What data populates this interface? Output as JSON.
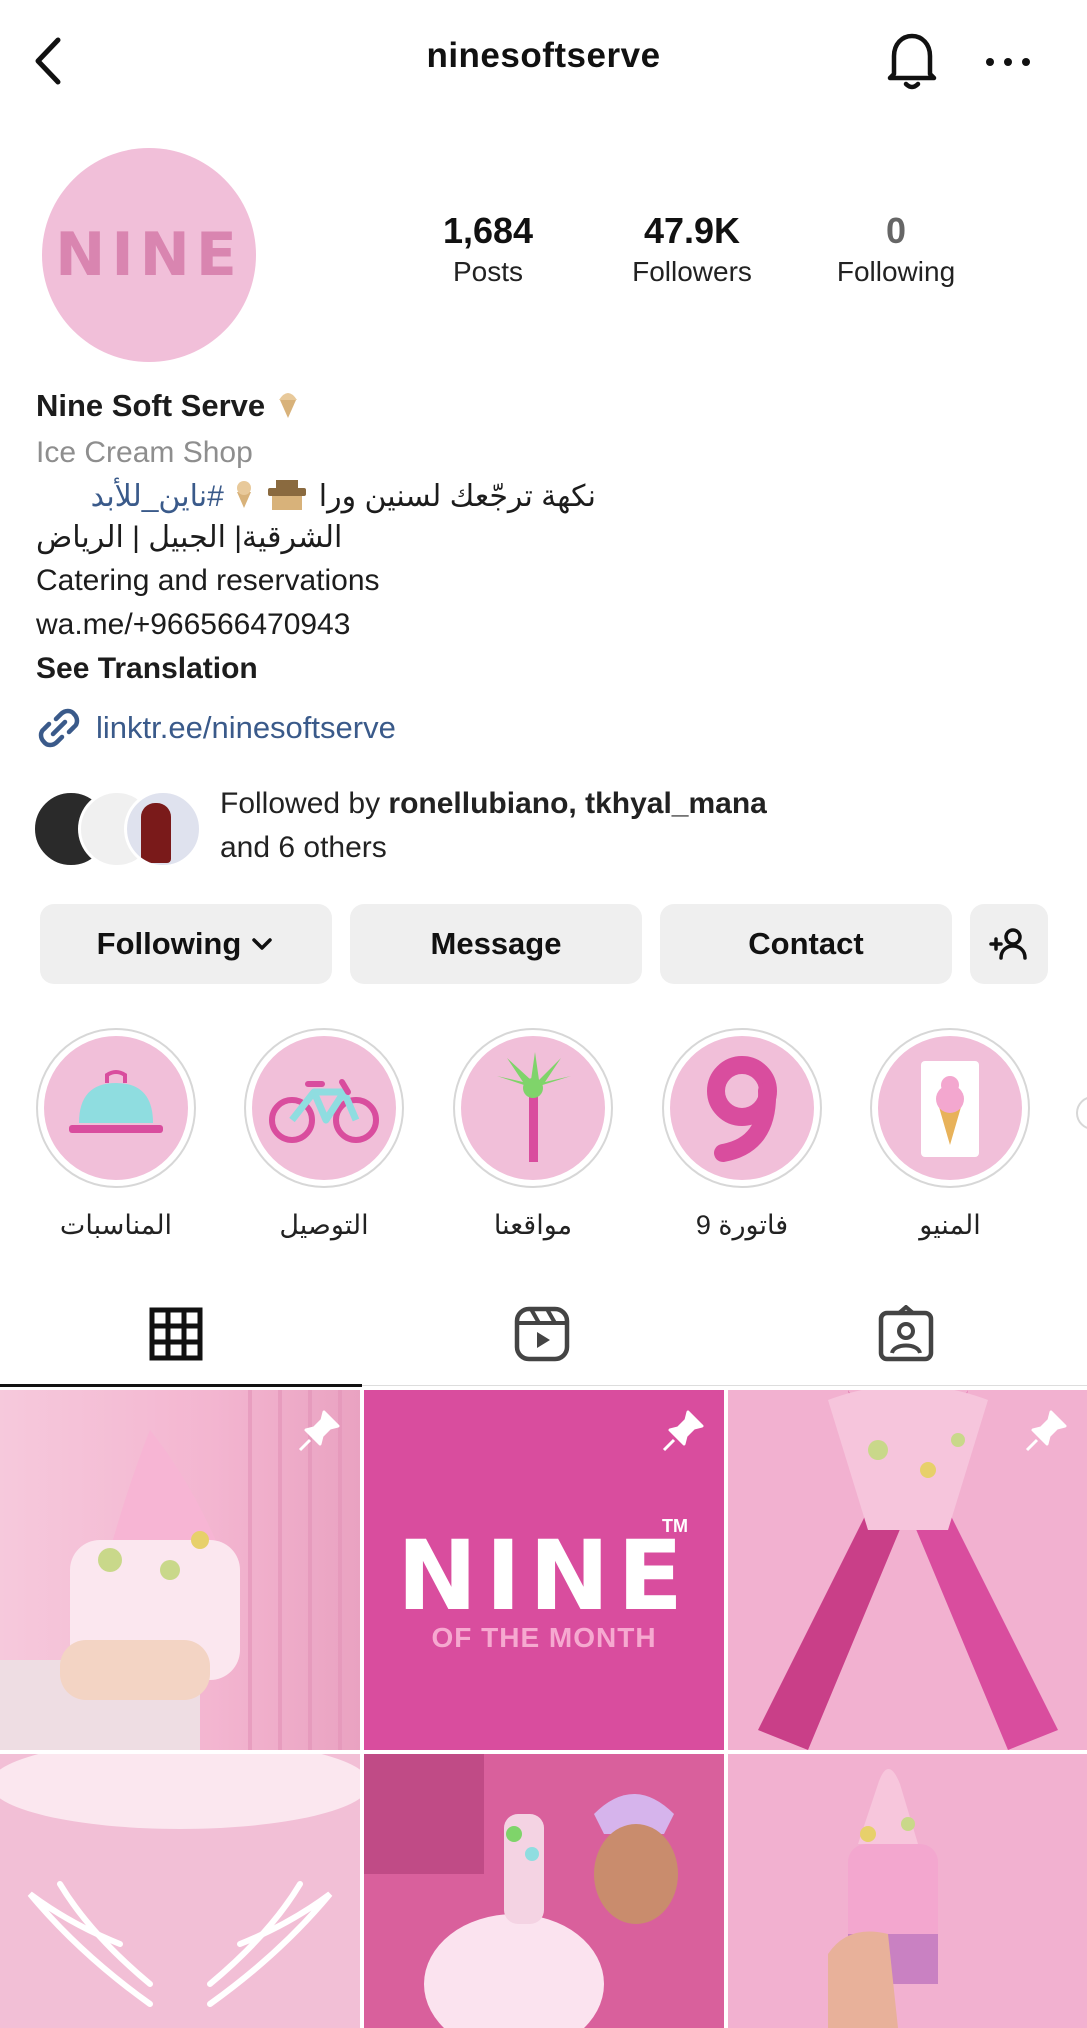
{
  "header": {
    "username": "ninesoftserve"
  },
  "profile": {
    "avatar_text": "NINE",
    "stats": [
      {
        "value": "1,684",
        "label": "Posts"
      },
      {
        "value": "47.9K",
        "label": "Followers"
      },
      {
        "value": "0",
        "label": "Following"
      }
    ],
    "name": "Nine Soft Serve",
    "category": "Ice Cream Shop",
    "bio_line1_text": "نكهة ترجّعك لسنين ورا",
    "bio_line1_tag": "#ناين_للأبد",
    "bio_line2": "الشرقية| الجبيل | الرياض",
    "bio_line3": "Catering and reservations",
    "bio_line4": "wa.me/+966566470943",
    "see_translation": "See Translation",
    "link": "linktr.ee/ninesoftserve"
  },
  "followed_by": {
    "prefix": "Followed by ",
    "names": "ronellubiano, tkhyal_mana",
    "suffix": "and 6 others"
  },
  "actions": {
    "following": "Following",
    "message": "Message",
    "contact": "Contact"
  },
  "highlights": [
    {
      "label": "المناسبات",
      "icon": "cloche-icon"
    },
    {
      "label": "التوصيل",
      "icon": "bicycle-icon"
    },
    {
      "label": "مواقعنا",
      "icon": "palm-tree-icon"
    },
    {
      "label": "فاتورة 9",
      "icon": "number-nine-icon"
    },
    {
      "label": "المنيو",
      "icon": "ice-cream-cone-icon"
    }
  ],
  "tabs": [
    "grid-icon",
    "reels-icon",
    "tagged-icon"
  ],
  "posts": [
    {
      "pinned": true,
      "caption": ""
    },
    {
      "pinned": true,
      "caption": "NINE",
      "subcaption": "OF THE MONTH",
      "mark": "TM"
    },
    {
      "pinned": true,
      "caption": ""
    },
    {
      "pinned": false,
      "caption": ""
    },
    {
      "pinned": false,
      "caption": ""
    },
    {
      "pinned": false,
      "caption": ""
    }
  ],
  "colors": {
    "pink_light": "#f1bfd9",
    "pink_deep": "#d94d9e",
    "link": "#3a5a8a",
    "button_bg": "#efefef"
  }
}
